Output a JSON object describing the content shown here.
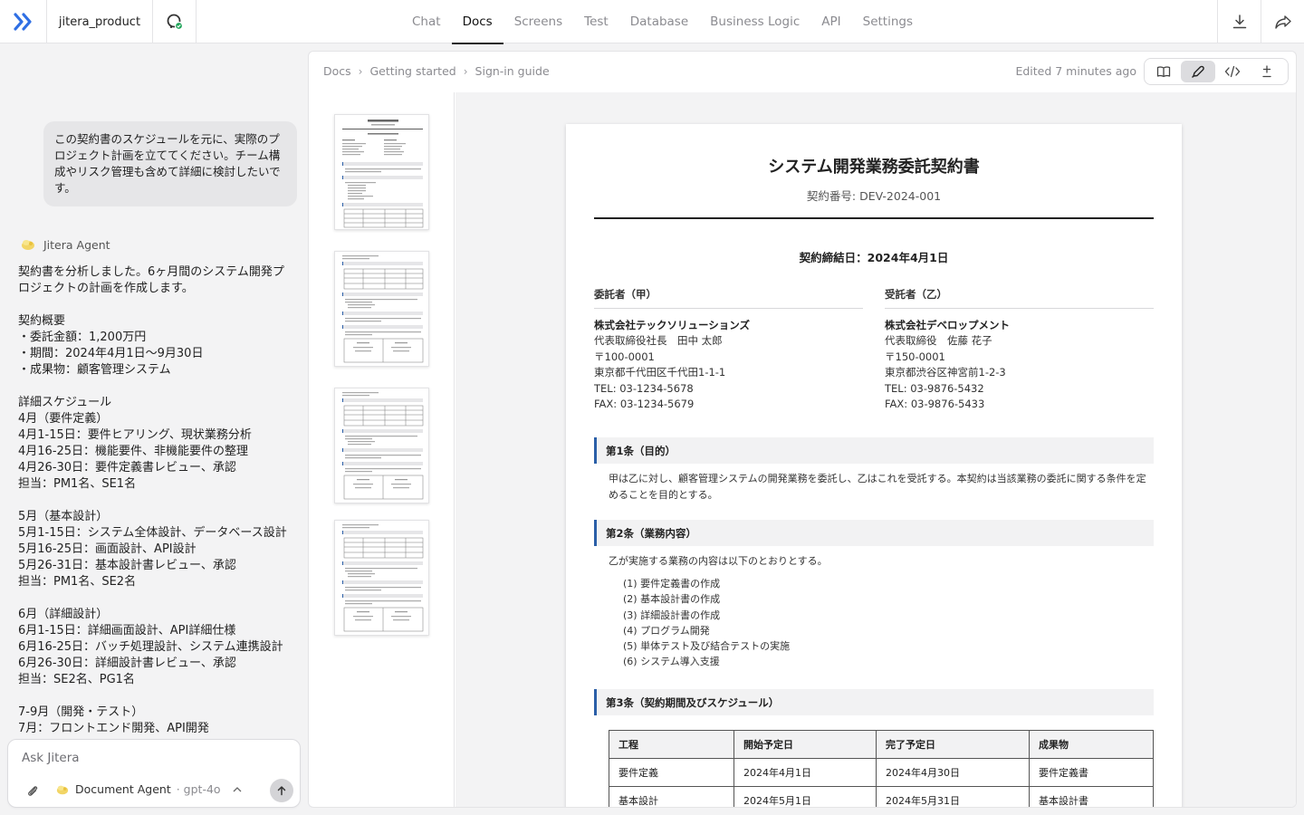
{
  "topbar": {
    "project_name": "jitera_product",
    "nav": [
      "Chat",
      "Docs",
      "Screens",
      "Test",
      "Database",
      "Business Logic",
      "API",
      "Settings"
    ],
    "active_nav": "Docs",
    "brand_color": "#2f6fe4"
  },
  "chat": {
    "user_message": "この契約書のスケジュールを元に、実際のプロジェクト計画を立ててください。チーム構成やリスク管理も含めて詳細に検討したいです。",
    "agent_name": "Jitera Agent",
    "agent_message": "契約書を分析しました。6ヶ月間のシステム開発プロジェクトの計画を作成します。\n\n契約概要\n・委託金額：1,200万円\n・期間：2024年4月1日〜9月30日\n・成果物：顧客管理システム\n\n詳細スケジュール\n4月（要件定義）\n4月1-15日：要件ヒアリング、現状業務分析\n4月16-25日：機能要件、非機能要件の整理\n4月26-30日：要件定義書レビュー、承認\n担当：PM1名、SE1名\n\n5月（基本設計）\n5月1-15日：システム全体設計、データベース設計\n5月16-25日：画面設計、API設計\n5月26-31日：基本設計書レビュー、承認\n担当：PM1名、SE2名\n\n6月（詳細設計）\n6月1-15日：詳細画面設計、API詳細仕様\n6月16-25日：バッチ処理設計、システム連携設計\n6月26-30日：詳細設計書レビュー、承認\n担当：SE2名、PG1名\n\n7-9月（開発・テスト）\n7月：フロントエンド開発、API開発",
    "composer": {
      "placeholder": "Ask Jitera",
      "agent_label": "Document Agent",
      "model_label": "· gpt-4o"
    }
  },
  "docs": {
    "breadcrumb": [
      "Docs",
      "Getting started",
      "Sign-in guide"
    ],
    "edited": "Edited 7 minutes ago",
    "view_modes": [
      "book-icon",
      "pen-icon",
      "code-icon",
      "plus-minus-icon"
    ],
    "active_view": "pen-icon"
  },
  "document": {
    "title": "システム開発業務委託契約書",
    "contract_no": "契約番号: DEV-2024-001",
    "date": "契約締結日：2024年4月1日",
    "party_a": {
      "heading": "委託者（甲）",
      "company": "株式会社テックソリューションズ",
      "rep": "代表取締役社長　田中 太郎",
      "zip": "〒100-0001",
      "address": "東京都千代田区千代田1-1-1",
      "tel": "TEL: 03-1234-5678",
      "fax": "FAX: 03-1234-5679"
    },
    "party_b": {
      "heading": "受託者（乙）",
      "company": "株式会社デベロップメント",
      "rep": "代表取締役　佐藤 花子",
      "zip": "〒150-0001",
      "address": "東京都渋谷区神宮前1-2-3",
      "tel": "TEL: 03-9876-5432",
      "fax": "FAX: 03-9876-5433"
    },
    "article1": {
      "heading": "第1条（目的）",
      "body": "甲は乙に対し、顧客管理システムの開発業務を委託し、乙はこれを受託する。本契約は当該業務の委託に関する条件を定めることを目的とする。"
    },
    "article2": {
      "heading": "第2条（業務内容）",
      "intro": "乙が実施する業務の内容は以下のとおりとする。",
      "items": [
        "(1) 要件定義書の作成",
        "(2) 基本設計書の作成",
        "(3) 詳細設計書の作成",
        "(4) プログラム開発",
        "(5) 単体テスト及び結合テストの実施",
        "(6) システム導入支援"
      ]
    },
    "article3": {
      "heading": "第3条（契約期間及びスケジュール）"
    },
    "schedule": {
      "headers": [
        "工程",
        "開始予定日",
        "完了予定日",
        "成果物"
      ],
      "rows": [
        [
          "要件定義",
          "2024年4月1日",
          "2024年4月30日",
          "要件定義書"
        ],
        [
          "基本設計",
          "2024年5月1日",
          "2024年5月31日",
          "基本設計書"
        ]
      ]
    }
  }
}
